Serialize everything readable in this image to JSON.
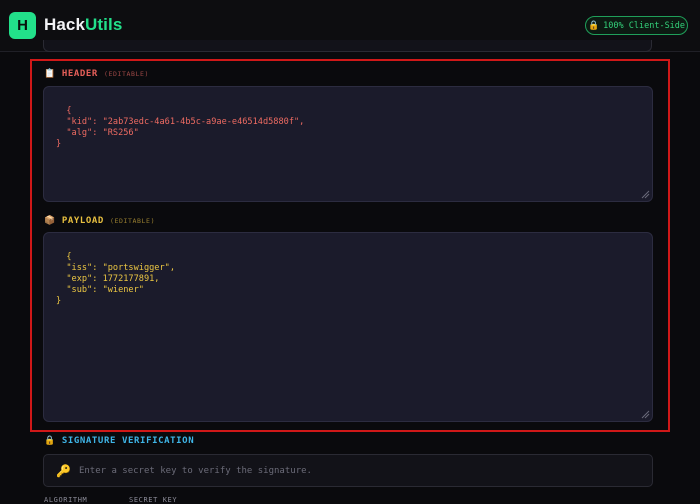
{
  "brand": {
    "logo_letter": "H",
    "name_part1": "Hack",
    "name_part2": "Utils"
  },
  "badge": {
    "icon": "lock-icon",
    "label": "100% Client-Side"
  },
  "header_section": {
    "icon": "clipboard-icon",
    "label": "HEADER",
    "sublabel": "(EDITABLE)",
    "content": "{\n  \"kid\": \"2ab73edc-4a61-4b5c-a9ae-e46514d5880f\",\n  \"alg\": \"RS256\"\n}"
  },
  "payload_section": {
    "icon": "package-icon",
    "label": "PAYLOAD",
    "sublabel": "(EDITABLE)",
    "content": "{\n  \"iss\": \"portswigger\",\n  \"exp\": 1772177891,\n  \"sub\": \"wiener\"\n}"
  },
  "signature_section": {
    "icon": "lock-icon",
    "label": "SIGNATURE VERIFICATION",
    "input_icon": "key-icon",
    "placeholder": "Enter a secret key to verify the signature."
  },
  "bottom_labels": {
    "algorithm": "ALGORITHM",
    "secret_key": "SECRET KEY"
  },
  "colors": {
    "accent": "#22e08a",
    "header_text": "#ee6b62",
    "payload_text": "#ecc743",
    "signature_label": "#3fb6e8",
    "highlight_frame": "#d01818"
  }
}
